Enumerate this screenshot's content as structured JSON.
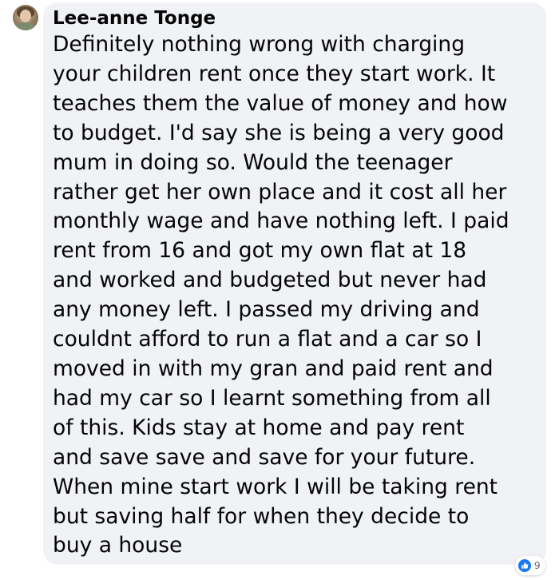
{
  "comment": {
    "author": "Lee-anne Tonge",
    "text_lines": [
      "Definitely nothing wrong with charging",
      "your children rent once they start work. It",
      "teaches them the value of money and how",
      "to budget. I'd say she is being a very good",
      "mum in doing so. Would the teenager",
      "rather get her own place and it cost all her",
      "monthly wage and have nothing left. I paid",
      "rent from 16 and got my own flat at 18",
      "and worked and budgeted but never had",
      "any money left. I passed my driving and",
      "couldnt afford to run a flat and a car so I",
      "moved in with my gran and paid rent and",
      "had my car so I learnt something from all",
      "of this. Kids stay at home and pay rent",
      "and save save and save for your future.",
      "When mine start work I will be taking rent",
      "but saving half for when they decide to",
      "buy a house"
    ],
    "avatar_icon": "profile-photo",
    "reactions": {
      "icon": "thumbs-up-icon",
      "count": "9",
      "color": "#1877f2"
    }
  }
}
